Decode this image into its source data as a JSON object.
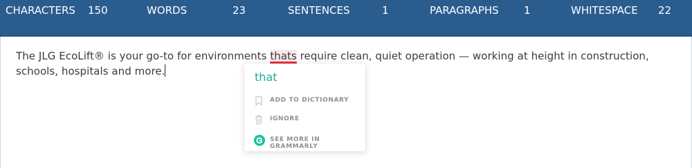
{
  "stats": {
    "characters_label": "CHARACTERS",
    "characters_value": "150",
    "words_label": "WORDS",
    "words_value": "23",
    "sentences_label": "SENTENCES",
    "sentences_value": "1",
    "paragraphs_label": "PARAGRAPHS",
    "paragraphs_value": "1",
    "whitespace_label": "WHITESPACE",
    "whitespace_value": "22"
  },
  "editor": {
    "text_before": "The JLG EcoLift® is your go-to for environments ",
    "error_word": "thats",
    "text_after": " require clean, quiet operation — working at height in construction, schools, hospitals and more."
  },
  "popup": {
    "suggestion": "that",
    "add_to_dictionary": "ADD TO DICTIONARY",
    "ignore": "IGNORE",
    "see_more": "SEE MORE IN GRAMMARLY"
  },
  "icons": {
    "add_to_dictionary": "bookmark-icon",
    "ignore": "trash-icon",
    "see_more": "grammarly-logo-icon"
  },
  "colors": {
    "stats_bar": "#2a5d8e",
    "suggestion": "#15b095",
    "error_underline": "#e4343c",
    "grammarly_green": "#15c39a"
  }
}
